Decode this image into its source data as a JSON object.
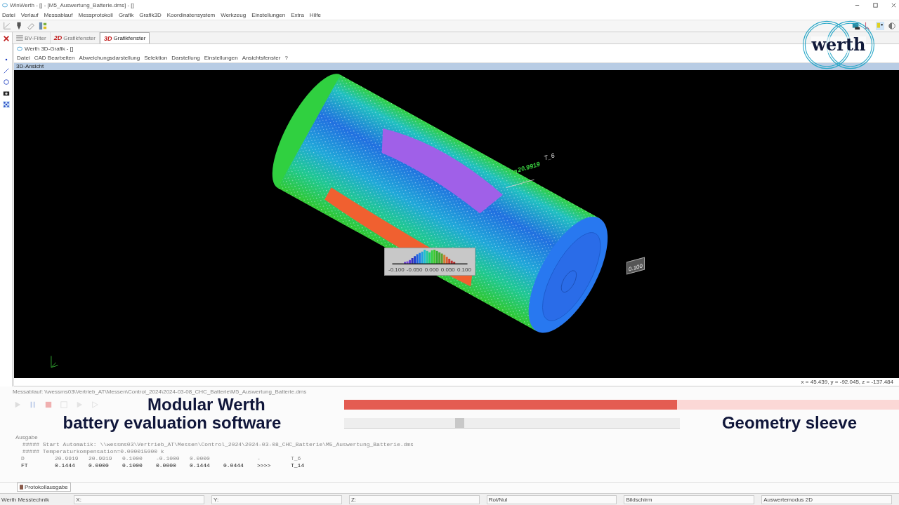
{
  "window": {
    "title": "WinWerth - [] - [M5_Auswertung_Batterie.dms] - []"
  },
  "menu": [
    "Datei",
    "Verlauf",
    "Messablauf",
    "Messprotokoll",
    "Grafik",
    "Grafik3D",
    "Koordinatensystem",
    "Werkzeug",
    "Einstellungen",
    "Extra",
    "Hilfe"
  ],
  "tabs": [
    {
      "label": "BV-Filter",
      "kind": "list",
      "selected": false
    },
    {
      "label": "Grafikfenster",
      "kind": "plane",
      "badge": "2D",
      "selected": false
    },
    {
      "label": "Grafikfenster",
      "kind": "volume",
      "badge": "3D",
      "selected": true
    }
  ],
  "graphics_window": {
    "title": "Werth 3D-Grafik - []",
    "menu": [
      "Datei",
      "CAD Bearbeiten",
      "Abweichungsdarstellung",
      "Selektion",
      "Darstellung",
      "Einstellungen",
      "Ansichtsfenster",
      "?"
    ],
    "view_title": "3D-Ansicht"
  },
  "viewport": {
    "measurement": "⌀ 20.9919",
    "feature": "T_6",
    "legend_ticks": [
      "-0.100",
      "-0.050",
      "0.000",
      "0.050",
      "0.100"
    ],
    "side_tag": "0.100",
    "coordinates": "x = 45.439, y = -92.045, z = -137.484"
  },
  "program_path": "Messablauf: \\\\wessms03\\Vertrieb_AT\\Messen\\Control_2024\\2024-03-08_CHC_Batterie\\M5_Auswertung_Batterie.dms",
  "run_bar": {
    "level": 0.6
  },
  "slider": {
    "level": 0.35
  },
  "captions": {
    "title_line_1": "Modular Werth",
    "title_line_2": "battery evaluation software",
    "section": "Geometry sleeve"
  },
  "output": {
    "title": "Ausgabe",
    "lines": [
      "#####  Start Automatik: \\\\wessms03\\Vertrieb_AT\\Messen\\Control_2024\\2024-03-08_CHC_Batterie\\M5_Auswertung_Batterie.dms",
      "#####  Temperaturkompensation=0.000015000 k"
    ],
    "rows": [
      [
        "D",
        "20.9919",
        "20.9919",
        "0.1000",
        "-0.1000",
        "0.0000",
        "",
        "-",
        "T_6"
      ],
      [
        "FT",
        "0.1444",
        "0.0000",
        "0.1000",
        "0.0000",
        "0.1444",
        "0.0444",
        ">>>>",
        "T_14"
      ]
    ],
    "tab": "Protokollausgabe"
  },
  "status_bar": {
    "company": "Werth Messtechnik",
    "fields": [
      "X:",
      "Y:",
      "Z:",
      "Rot/Nul",
      "Bildschirm",
      "Auswertemodus 2D"
    ]
  },
  "logo": {
    "text": "werth"
  }
}
